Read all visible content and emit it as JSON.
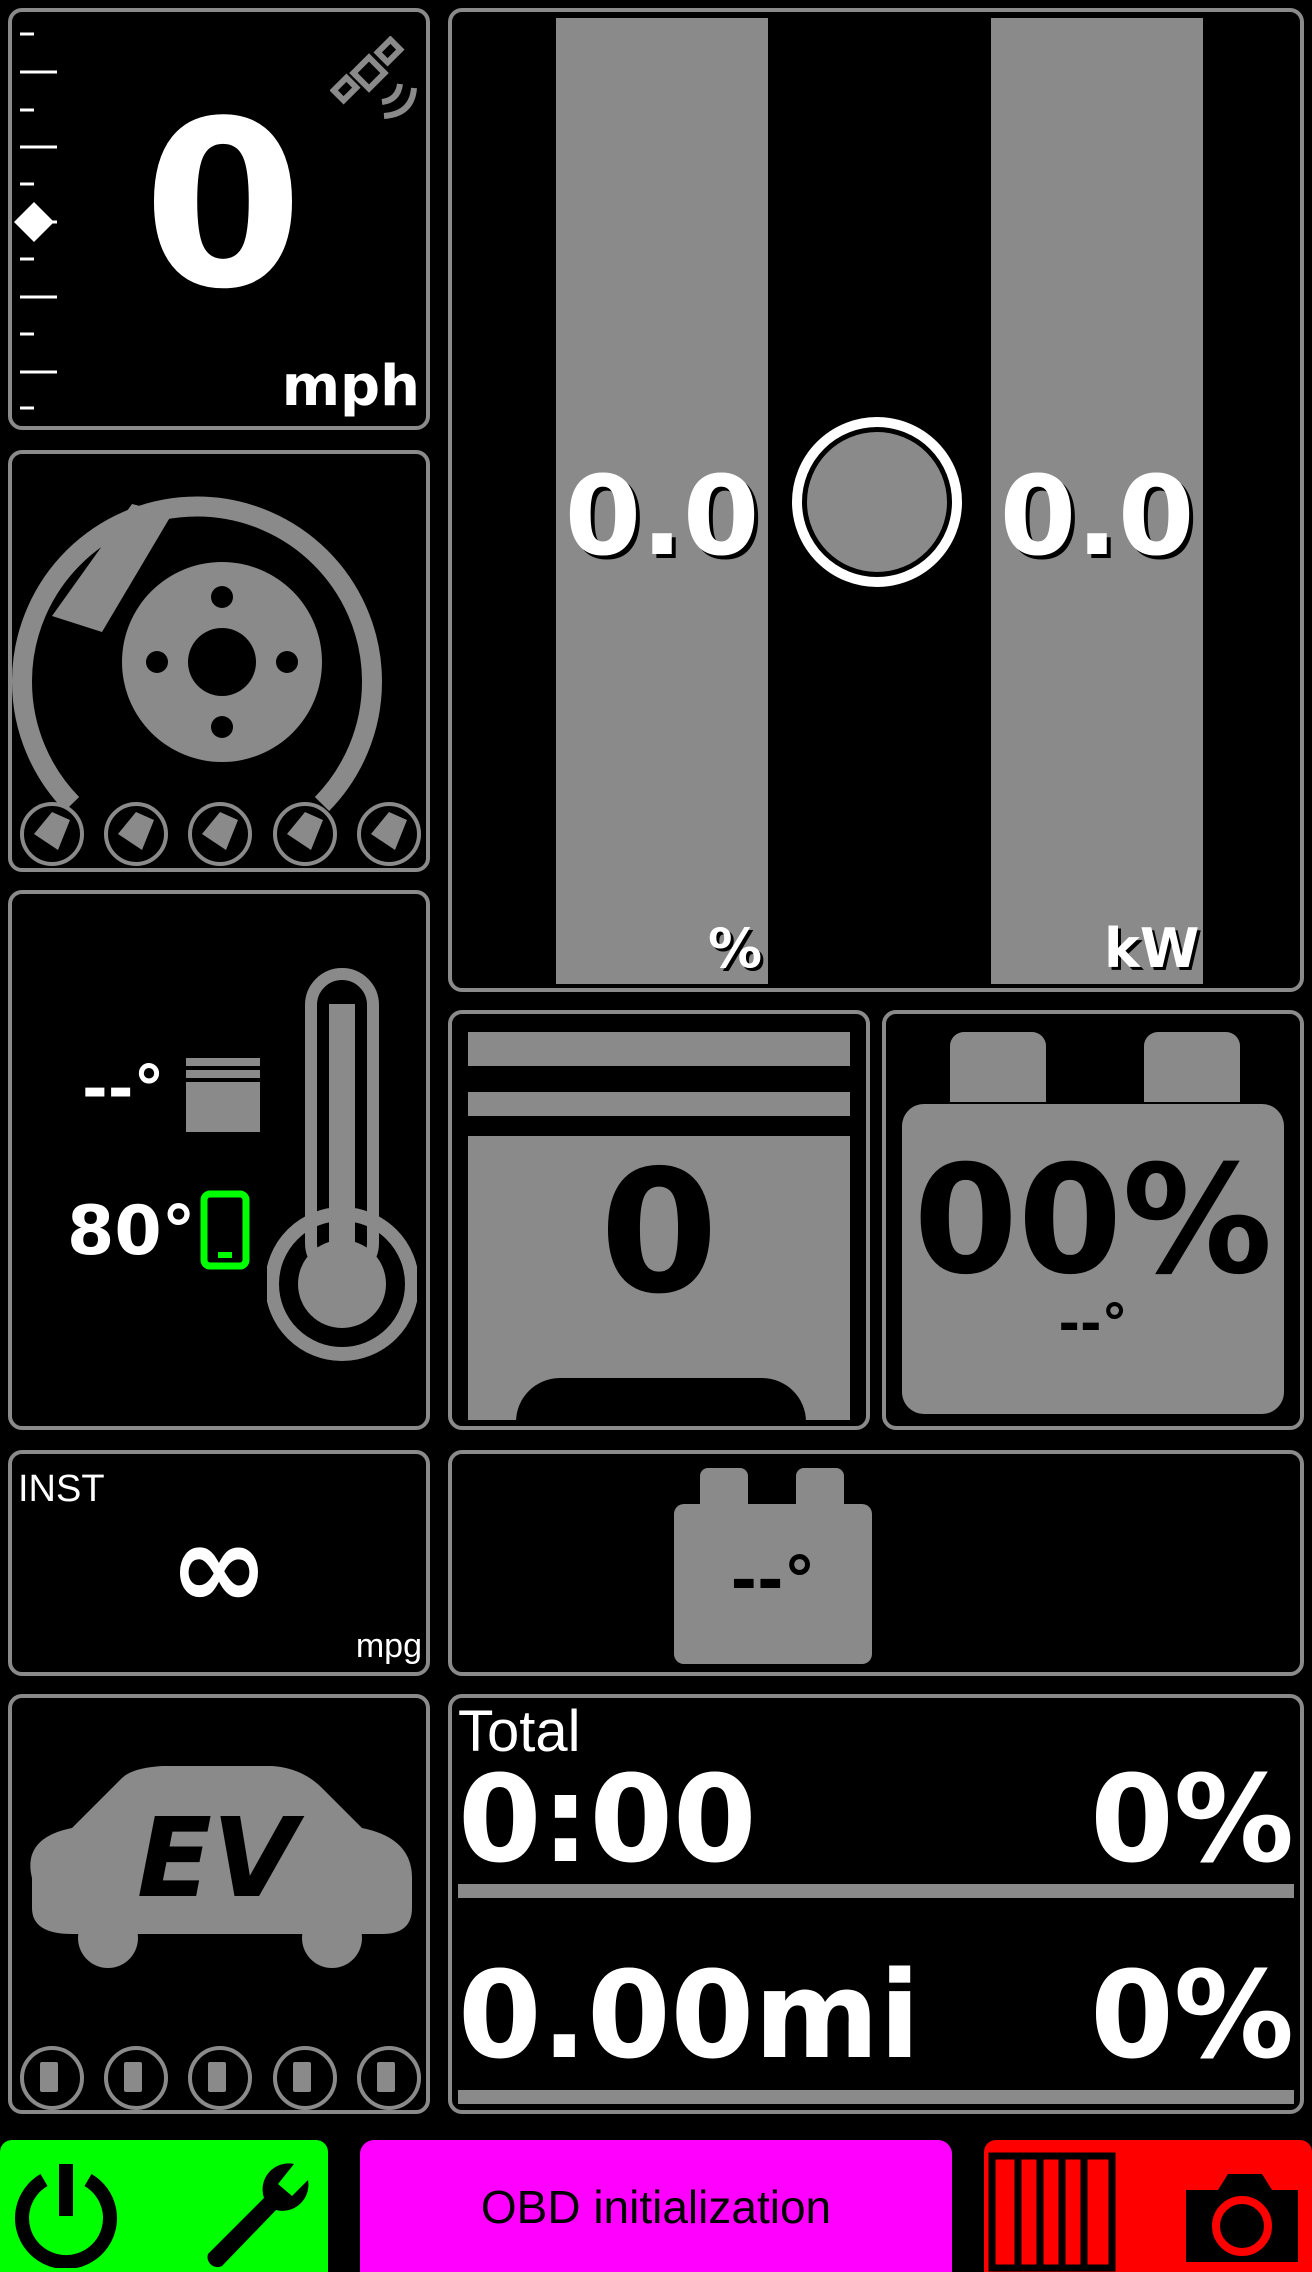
{
  "speed": {
    "value": "0",
    "unit": "mph"
  },
  "power": {
    "left_value": "0.0",
    "left_unit": "%",
    "right_value": "0.0",
    "right_unit": "kW"
  },
  "temps": {
    "engine": "--°",
    "phone": "80°"
  },
  "gear": {
    "value": "0"
  },
  "battery": {
    "percent": "00%",
    "temp": "--°"
  },
  "aux_battery": {
    "value": "--°"
  },
  "economy": {
    "label": "INST",
    "value": "∞",
    "unit": "mpg"
  },
  "trip": {
    "label": "Total",
    "time": "0:00",
    "time_pct": "0%",
    "distance": "0.00mi",
    "distance_pct": "0%"
  },
  "status": {
    "message": "OBD initialization"
  },
  "colors": {
    "accent_green": "#00ff00",
    "accent_magenta": "#ff00ff",
    "accent_red": "#ff0000",
    "panel_gray": "#8a8a8a"
  }
}
